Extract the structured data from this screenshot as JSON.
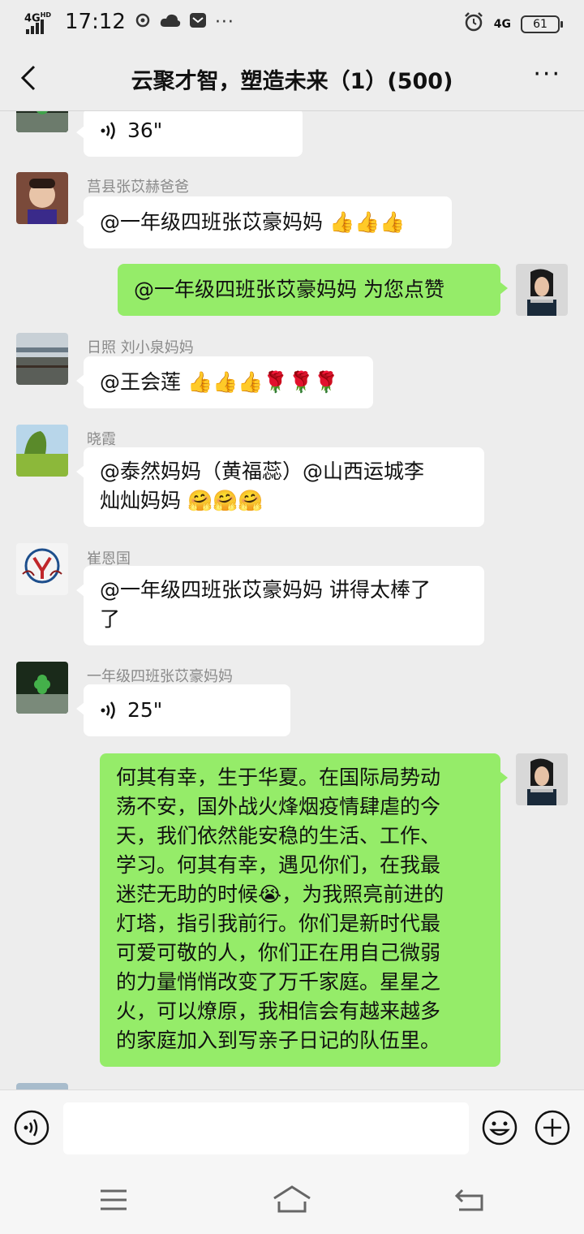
{
  "status_bar": {
    "network": "4G",
    "network_sup": "HD",
    "time": "17:12",
    "lte": "4G",
    "battery": "61"
  },
  "header": {
    "title": "云聚才智，塑造未来（1）(500)",
    "more": "···"
  },
  "messages": [
    {
      "side": "left",
      "type": "voice",
      "sender": "",
      "duration": "36\""
    },
    {
      "side": "left",
      "type": "text",
      "sender": "莒县张苡赫爸爸",
      "text": "@一年级四班张苡豪妈妈 👍👍👍"
    },
    {
      "side": "right",
      "type": "text",
      "sender": "",
      "text": "@一年级四班张苡豪妈妈  为您点赞"
    },
    {
      "side": "left",
      "type": "text",
      "sender": "日照  刘小泉妈妈",
      "text": "@王会莲 👍👍👍🌹🌹🌹"
    },
    {
      "side": "left",
      "type": "text",
      "sender": "晓霞",
      "line1": "@泰然妈妈（黄福蕊）@山西运城李",
      "line2": "灿灿妈妈 🤗🤗🤗"
    },
    {
      "side": "left",
      "type": "text",
      "sender": "崔恩国",
      "line1": "@一年级四班张苡豪妈妈  讲得太棒了",
      "line2": "了"
    },
    {
      "side": "left",
      "type": "voice",
      "sender": "一年级四班张苡豪妈妈",
      "duration": "25\""
    },
    {
      "side": "right",
      "type": "text",
      "sender": "",
      "lines": [
        "何其有幸，生于华夏。在国际局势动",
        "荡不安，国外战火烽烟疫情肆虐的今",
        "天，我们依然能安稳的生活、工作、",
        "学习。何其有幸，遇见你们，在我最",
        "迷茫无助的时候😭，为我照亮前进的",
        "灯塔，指引我前行。你们是新时代最",
        "可爱可敬的人，你们正在用自己微弱",
        "的力量悄悄改变了万千家庭。星星之",
        "火，可以燎原，我相信会有越来越多",
        "的家庭加入到写亲子日记的队伍里。"
      ]
    }
  ],
  "colors": {
    "bg": "#ededed",
    "own_bubble": "#95ec69",
    "other_bubble": "#ffffff"
  }
}
